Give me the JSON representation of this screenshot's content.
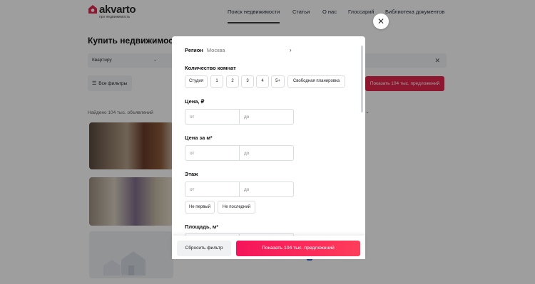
{
  "header": {
    "logo_name": "akvarto",
    "logo_sub": "про недвижимость",
    "nav": [
      "Поиск недвижимости",
      "Статьи",
      "О нас",
      "Глоссарий",
      "Библиотека документов"
    ]
  },
  "page": {
    "title": "Купить недвижимость",
    "property_type": "Квартиру",
    "filters_label": "Все фильтры",
    "show_offers_label": "Показать 104 тыс. предложений",
    "found_label": "Найдено 104 тыс. объявлений"
  },
  "modal": {
    "region_label": "Регион",
    "region_value": "Москва",
    "rooms_label": "Количество комнат",
    "rooms_options": [
      "Студия",
      "1",
      "2",
      "3",
      "4",
      "5+",
      "Свободная планировка"
    ],
    "price_label": "Цена, ₽",
    "price_per_m2_label": "Цена за м²",
    "floor_label": "Этаж",
    "floor_options": [
      "Не первый",
      "Не последний"
    ],
    "area_label": "Площадь, м²",
    "from_placeholder": "от",
    "to_placeholder": "до",
    "reset_label": "Сбросить фильтр",
    "apply_label": "Показать 104 тыс. предложений"
  },
  "colors": {
    "accent": "#f4145a",
    "brand": "#e2264d"
  },
  "icons": {
    "close": "close-icon",
    "chevron": "chevron-right-icon",
    "filters": "sliders-icon",
    "logo": "house-logo-icon"
  }
}
